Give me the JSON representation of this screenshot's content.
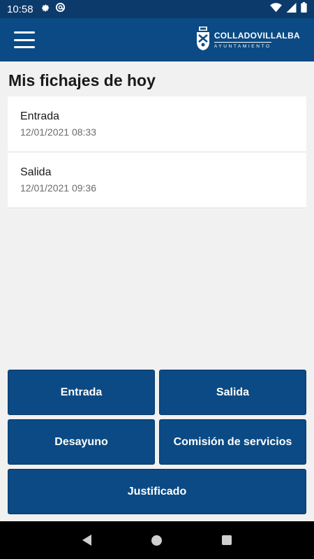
{
  "status_bar": {
    "time": "10:58",
    "icons_left": [
      "gear-icon",
      "at-icon"
    ],
    "icons_right": [
      "wifi-icon",
      "signal-icon",
      "battery-icon"
    ]
  },
  "app_bar": {
    "logo_name": "COLLADOVILLALBA",
    "logo_sub": "AYUNTAMIENTO",
    "menu_icon": "hamburger-menu-icon"
  },
  "page": {
    "title": "Mis fichajes de hoy"
  },
  "records": [
    {
      "type": "Entrada",
      "time": "12/01/2021 08:33"
    },
    {
      "type": "Salida",
      "time": "12/01/2021 09:36"
    }
  ],
  "buttons": {
    "entrada": "Entrada",
    "salida": "Salida",
    "desayuno": "Desayuno",
    "comision": "Comisión de servicios",
    "justificado": "Justificado"
  },
  "colors": {
    "primary": "#0b4a84",
    "status_bar": "#0b3a6b",
    "background": "#f1f1f1"
  }
}
